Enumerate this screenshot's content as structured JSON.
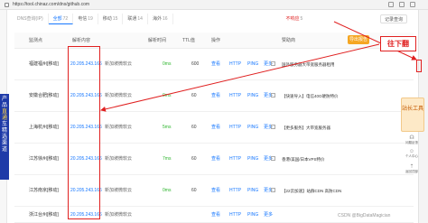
{
  "browser": {
    "url": "https://tool.chinaz.com/dns/github.com"
  },
  "left_promo": {
    "lines": [
      "产",
      "品",
      "直",
      "通",
      "车",
      "精",
      "选",
      "渠",
      "道"
    ]
  },
  "tabs": {
    "title": "DNS查询(IP)",
    "items": [
      {
        "label": "全部",
        "count": "72"
      },
      {
        "label": "电信",
        "count": "19"
      },
      {
        "label": "移动",
        "count": "15"
      },
      {
        "label": "联通",
        "count": "14"
      },
      {
        "label": "海外",
        "count": "16"
      }
    ],
    "failed": {
      "label": "不响应",
      "count": "5"
    },
    "report_label": "记录查询"
  },
  "table": {
    "headers": [
      "监测点",
      "解析内容",
      "",
      "解析时间",
      "TTL值",
      "操作",
      "赞助商"
    ],
    "export_label": "导出报告",
    "rows": [
      {
        "location": "福建福州[移动]",
        "ip": "20.205.243.166",
        "status": "新加坡微软云",
        "time": "0ms",
        "ttl": "600",
        "actions": [
          "查看",
          "HTTP",
          "PING",
          "更多"
        ],
        "sponsor": "国外服务器大带宽服务器租用"
      },
      {
        "location": "安徽合肥[移动]",
        "ip": "20.205.243.166",
        "status": "新加坡微软云",
        "time": "0ms",
        "ttl": "60",
        "actions": [
          "查看",
          "HTTP",
          "PING",
          "更多"
        ],
        "sponsor": "【快速导入】电信40G硬防特价"
      },
      {
        "location": "上海杭州[移动]",
        "ip": "20.205.243.166",
        "status": "新加坡微软云",
        "time": "5ms",
        "ttl": "60",
        "actions": [
          "查看",
          "HTTP",
          "PING",
          "更多"
        ],
        "sponsor": "【更多服务】大带宽服务器"
      },
      {
        "location": "江苏徐州[移动]",
        "ip": "20.205.243.166",
        "status": "新加坡微软云",
        "time": "7ms",
        "ttl": "60",
        "actions": [
          "查看",
          "HTTP",
          "PING",
          "更多"
        ],
        "sponsor": "香港/美国/日本VPS特价"
      },
      {
        "location": "江苏南京[移动]",
        "ip": "20.205.243.166",
        "status": "新加坡微软云",
        "time": "0ms",
        "ttl": "60",
        "actions": [
          "查看",
          "HTTP",
          "PING",
          "更多"
        ],
        "sponsor": "【22云加速】站群CDN 高防CDN"
      },
      {
        "location": "浙江台州[移动]",
        "ip": "20.205.243.166",
        "status": "新加坡微软云",
        "time": "",
        "ttl": "",
        "actions": [
          "查看",
          "HTTP",
          "PING",
          "更多"
        ],
        "sponsor": ""
      }
    ]
  },
  "annotation": {
    "callout": "往下翻"
  },
  "right_ad": {
    "text": "站长工具"
  },
  "right_icons": [
    {
      "icon": "headset-icon",
      "label": "问题反馈"
    },
    {
      "icon": "user-icon",
      "label": "个人中心"
    },
    {
      "icon": "top-icon",
      "label": "返回顶部"
    }
  ],
  "watermark": "CSDN @BigDataMagician",
  "colors": {
    "accent": "#1677ff",
    "annotation": "#e02020",
    "latency": "#2db52d",
    "export": "#f5a623"
  }
}
